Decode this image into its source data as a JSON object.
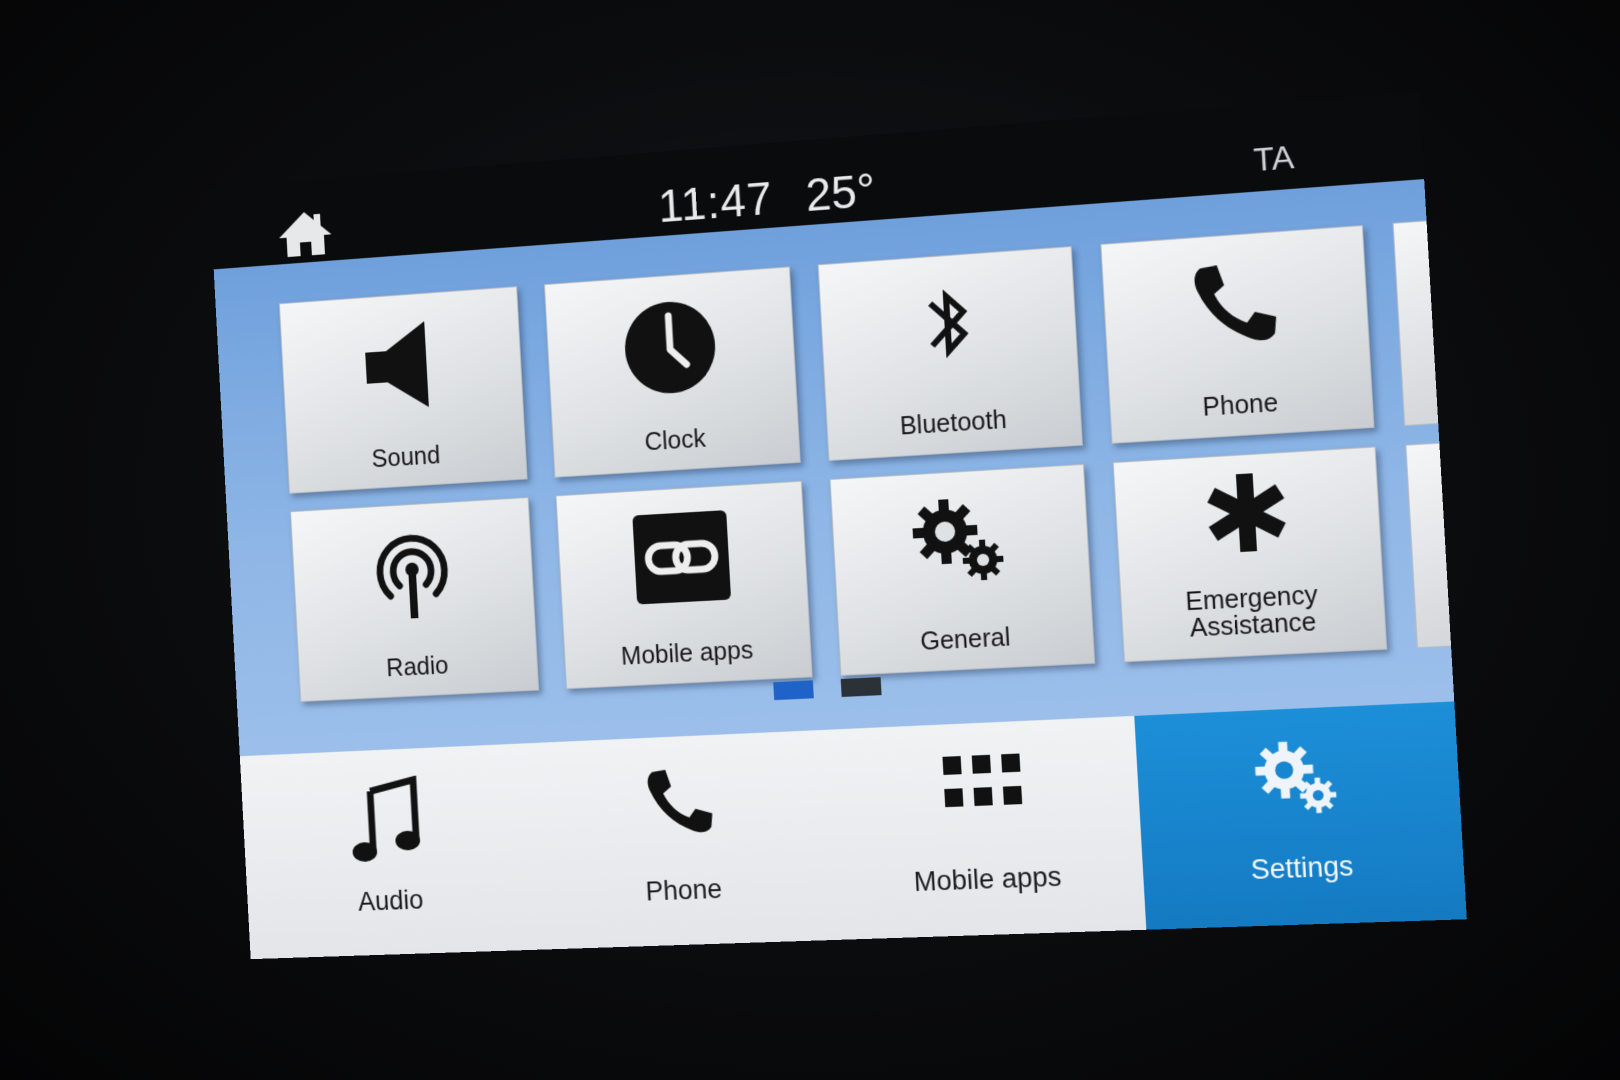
{
  "status": {
    "time": "11:47",
    "temperature": "25°",
    "ta": "TA"
  },
  "tiles": [
    {
      "label": "Sound",
      "icon": "speaker-icon"
    },
    {
      "label": "Clock",
      "icon": "clock-icon"
    },
    {
      "label": "Bluetooth",
      "icon": "bluetooth-icon"
    },
    {
      "label": "Phone",
      "icon": "phone-icon"
    },
    {
      "label": "Radio",
      "icon": "radio-antenna-icon"
    },
    {
      "label": "Mobile apps",
      "icon": "link-icon"
    },
    {
      "label": "General",
      "icon": "gears-icon"
    },
    {
      "label": "Emergency\nAssistance",
      "icon": "asterisk-icon"
    }
  ],
  "pager": {
    "pages": 2,
    "active": 1
  },
  "nav": [
    {
      "label": "Audio",
      "icon": "music-note-icon"
    },
    {
      "label": "Phone",
      "icon": "phone-icon"
    },
    {
      "label": "Mobile apps",
      "icon": "app-grid-icon"
    },
    {
      "label": "Settings",
      "icon": "gears-icon",
      "active": true
    }
  ],
  "colors": {
    "active_nav": "#1c8fd8",
    "pager_active": "#1f63c9",
    "content_bg": "#8eb6e6"
  }
}
